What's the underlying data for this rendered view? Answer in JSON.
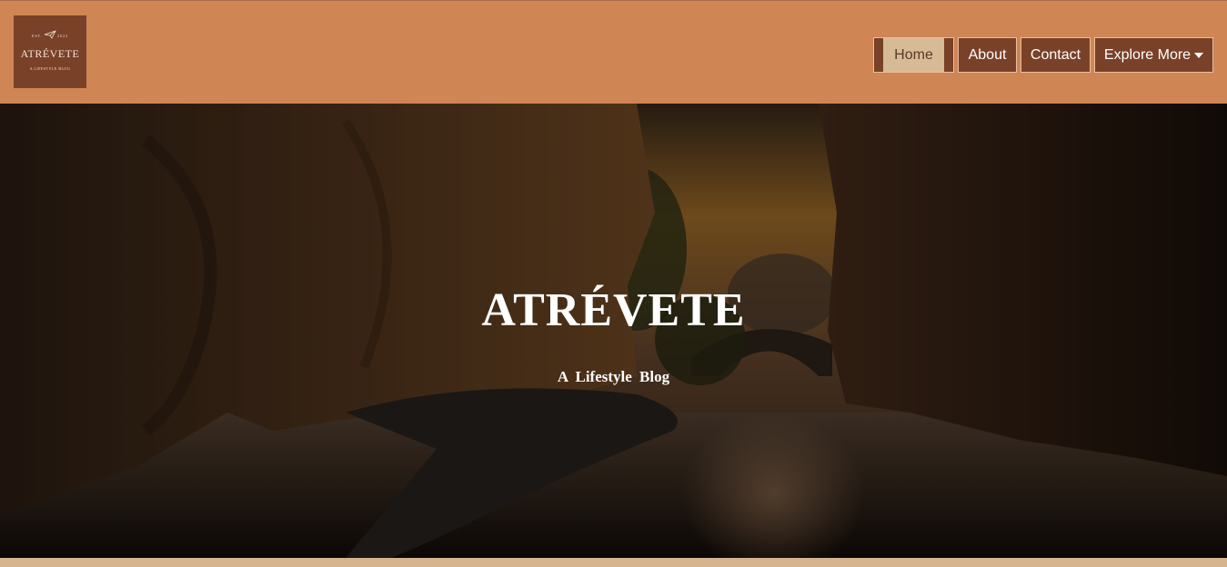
{
  "brand": {
    "logo_est": "EST.",
    "logo_year": "2022",
    "logo_name": "ATRÉVETE",
    "logo_tagline": "A LIFESTYLE BLOG"
  },
  "nav": {
    "items": [
      {
        "label": "Home",
        "active": true
      },
      {
        "label": "About"
      },
      {
        "label": "Contact"
      },
      {
        "label": "Explore More",
        "icon": "caret-down-icon"
      }
    ]
  },
  "hero": {
    "title": "ATRÉVETE",
    "subtitle": "A Lifestyle Blog"
  },
  "colors": {
    "header_bg": "#d08555",
    "nav_bg": "#7a4129",
    "nav_active_bg": "#d7ba96",
    "footer_band": "#d5b48e"
  }
}
